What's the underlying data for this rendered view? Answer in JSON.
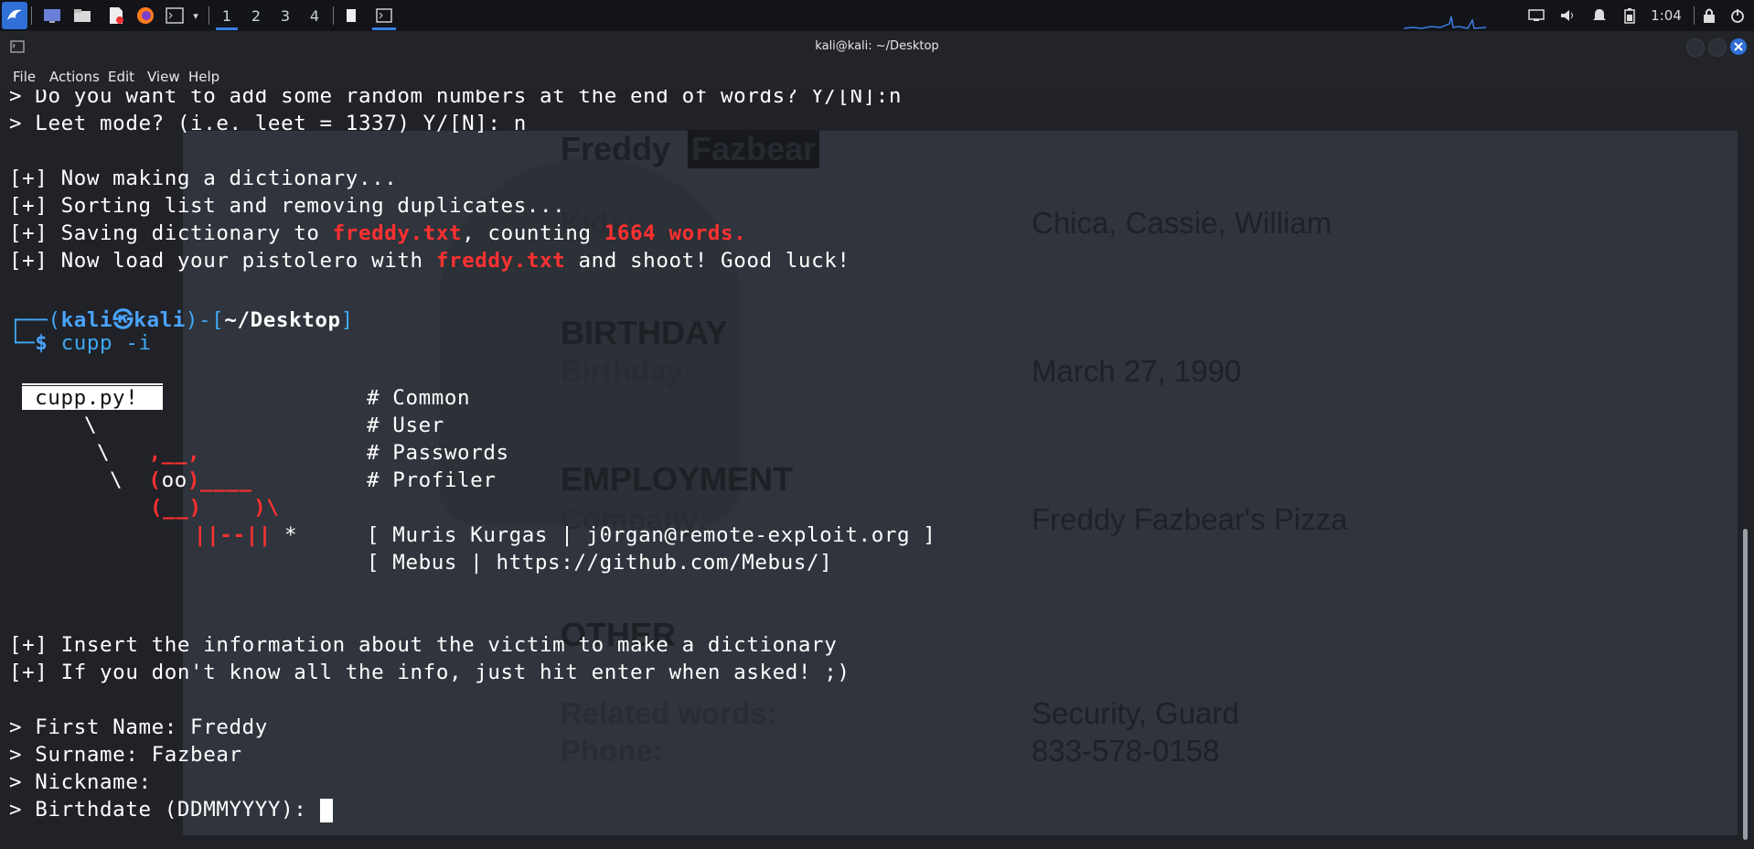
{
  "panel": {
    "workspaces": [
      "1",
      "2",
      "3",
      "4"
    ],
    "clock": "1:04"
  },
  "window": {
    "title": "kali@kali: ~/Desktop"
  },
  "menu": [
    "File",
    "Actions",
    "Edit",
    "View",
    "Help"
  ],
  "background_doc": {
    "name_first": "Freddy",
    "name_last": "Fazbear",
    "kids_label": "Kids:",
    "kids_value": "Chica, Cassie, William",
    "birthday_heading": "BIRTHDAY",
    "birthday_label": "Birthday:",
    "birthday_value": "March 27, 1990",
    "employment_heading": "EMPLOYMENT",
    "company_label": "Company:",
    "company_value": "Freddy Fazbear's Pizza",
    "other_heading": "OTHER",
    "related_label": "Related words:",
    "related_value": "Security, Guard",
    "phone_label": "Phone:",
    "phone_value": "833-578-0158"
  },
  "terminal": {
    "l1": "> Do you want to add some random numbers at the end of words? Y/[N]:n",
    "l2": "> Leet mode? (i.e. leet = 1337) Y/[N]: n",
    "l3": "[+] Now making a dictionary...",
    "l4": "[+] Sorting list and removing duplicates...",
    "l5a": "[+] Saving dictionary to ",
    "l5b": "freddy.txt",
    "l5c": ", counting ",
    "l5d": "1664 words.",
    "l6a": "[+] Now load your pistolero with ",
    "l6b": "freddy.txt",
    "l6c": " and shoot! Good luck!",
    "prompt_user": "kali",
    "prompt_host": "kali",
    "prompt_dir": "~/Desktop",
    "command": "cupp -i",
    "banner_box": " cupp.py! ",
    "banner_common": "# Common",
    "banner_user": "# User",
    "banner_passwords": "# Passwords",
    "banner_profiler": "# Profiler",
    "banner_author": "[ Muris Kurgas | j0rgan@remote-exploit.org ]",
    "banner_mebus": "[ Mebus | https://github.com/Mebus/]",
    "info1": "[+] Insert the information about the victim to make a dictionary",
    "info2": "[+] If you don't know all the info, just hit enter when asked! ;)",
    "q1": "> First Name: Freddy",
    "q2": "> Surname: Fazbear",
    "q3": "> Nickname:",
    "q4": "> Birthdate (DDMMYYYY): "
  }
}
